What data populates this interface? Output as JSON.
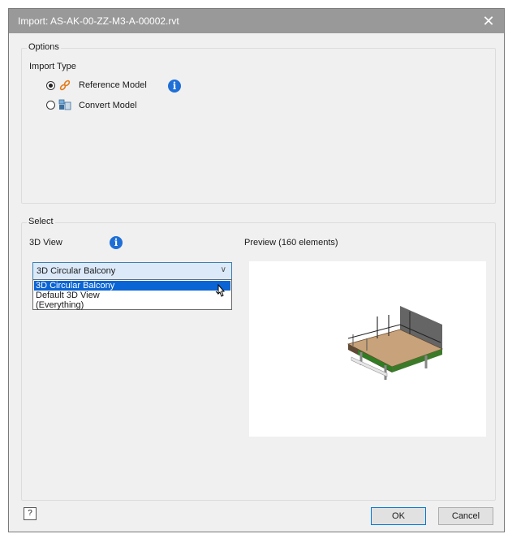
{
  "window": {
    "title": "Import: AS-AK-00-ZZ-M3-A-00002.rvt",
    "close": "✕"
  },
  "options": {
    "legend": "Options",
    "import_type_label": "Import Type",
    "reference_label": "Reference Model",
    "convert_label": "Convert Model",
    "selected": "Reference Model"
  },
  "select": {
    "legend": "Select",
    "view_label": "3D View",
    "preview_label": "Preview (160 elements)",
    "combo_value": "3D Circular Balcony",
    "dropdown_options": [
      "3D Circular Balcony",
      "Default 3D View",
      "(Everything)"
    ],
    "highlighted_option": "3D Circular Balcony"
  },
  "buttons": {
    "ok": "OK",
    "cancel": "Cancel",
    "help": "?"
  },
  "colors": {
    "titlebar": "#999999",
    "accent": "#0a64d4",
    "info": "#1e6fd6"
  }
}
